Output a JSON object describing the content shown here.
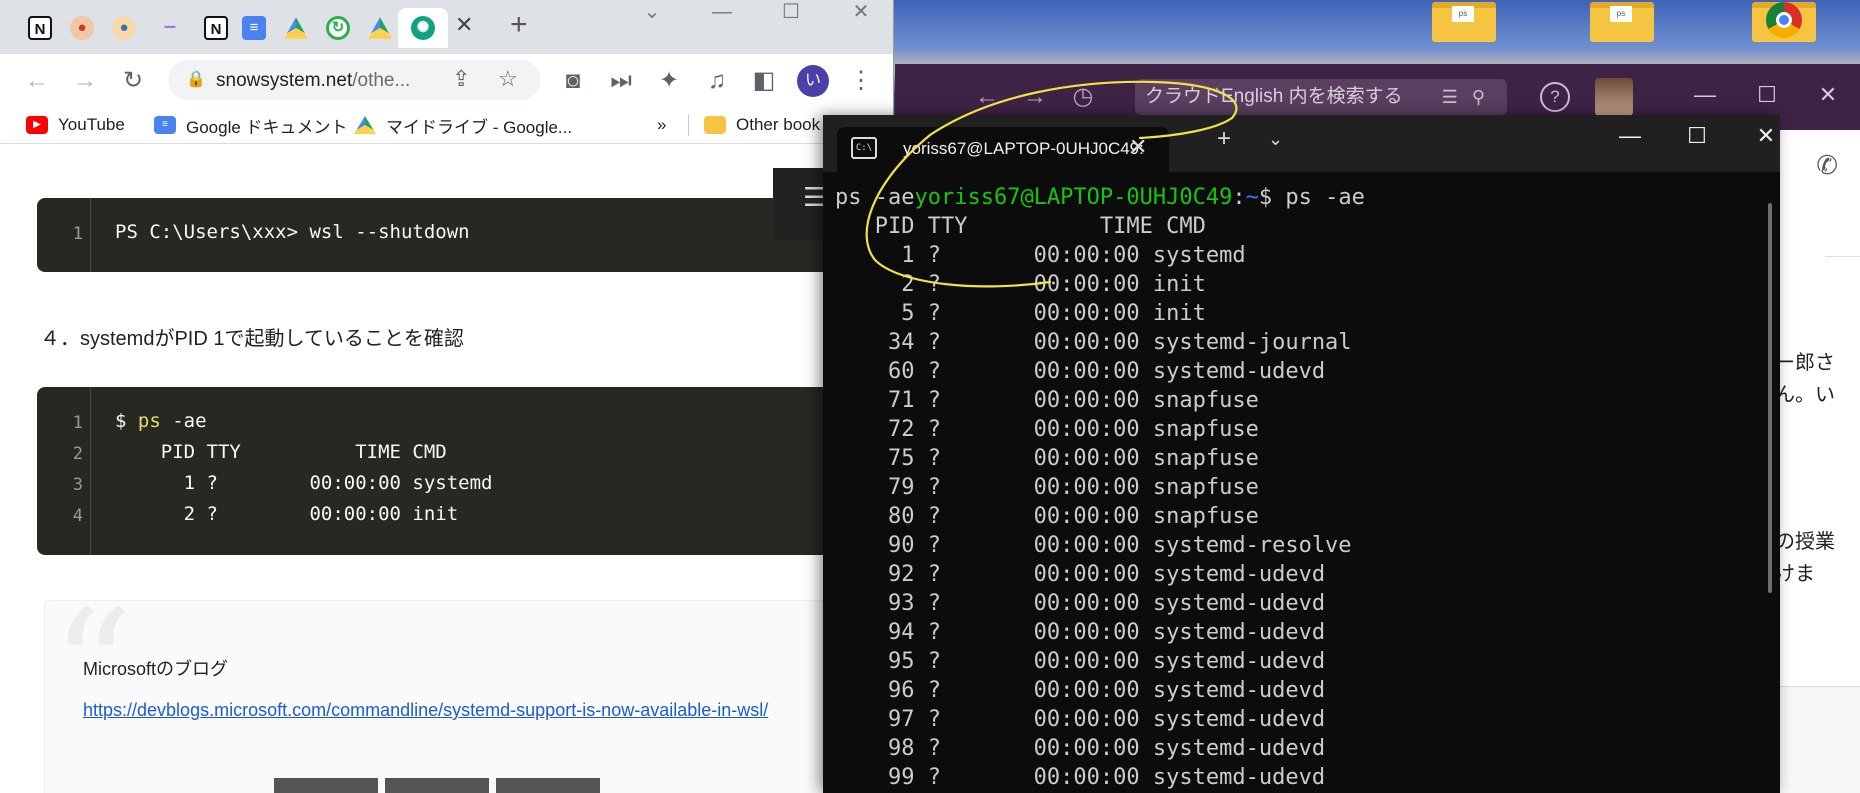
{
  "colors": {
    "terminal_bg": "#0c0c0c",
    "prompt_green": "#16c60c",
    "prompt_blue": "#3b78ff",
    "code_bg": "#272822",
    "slack_purple": "#3f2347",
    "annotation": "#f0e442"
  },
  "browser": {
    "tabs": [
      {
        "icon": "notion-icon",
        "glyph": "N",
        "cls": "notion"
      },
      {
        "icon": "avatar-icon",
        "glyph": "●",
        "cls": "person"
      },
      {
        "icon": "avatar-icon",
        "glyph": "●",
        "cls": "person2"
      },
      {
        "icon": "dash-icon",
        "glyph": "–",
        "cls": "dash"
      },
      {
        "icon": "notion-icon",
        "glyph": "N",
        "cls": "notion"
      },
      {
        "icon": "google-docs-icon",
        "glyph": "≡",
        "cls": "gdoc"
      },
      {
        "icon": "google-drive-icon",
        "glyph": "",
        "cls": "drive"
      },
      {
        "icon": "refresh-app-icon",
        "glyph": "↻",
        "cls": "green"
      },
      {
        "icon": "google-drive-icon",
        "glyph": "",
        "cls": "drive"
      },
      {
        "icon": "chatgpt-icon",
        "glyph": "✺",
        "cls": "gpt"
      }
    ],
    "url": {
      "host": "snowsystem.net",
      "path": "/othe..."
    },
    "profile_initial": "い",
    "bookmarks": [
      {
        "label": "YouTube",
        "icon": "youtube-icon",
        "cls": "yt",
        "glyph": "▶"
      },
      {
        "label": "Google ドキュメント",
        "icon": "google-docs-icon",
        "cls": "gd",
        "glyph": "≡"
      },
      {
        "label": "マイドライブ - Google...",
        "icon": "google-drive-icon",
        "cls": "dr",
        "glyph": ""
      }
    ],
    "bookmarks_more": "»",
    "other_bookmarks": "Other book"
  },
  "page": {
    "code1": [
      {
        "num": "1",
        "text": "PS C:\\Users\\xxx> wsl --shutdown"
      }
    ],
    "step4": "４．systemdがPID 1で起動していることを確認",
    "code2": [
      {
        "num": "1",
        "prefix": "$ ",
        "cmd": "ps",
        "rest": " -ae"
      },
      {
        "num": "2",
        "prefix": "",
        "cmd": "",
        "rest": "    PID TTY          TIME CMD"
      },
      {
        "num": "3",
        "prefix": "",
        "cmd": "",
        "rest": "      1 ?        00:00:00 systemd"
      },
      {
        "num": "4",
        "prefix": "",
        "cmd": "",
        "rest": "      2 ?        00:00:00 init"
      }
    ],
    "quote_title": "Microsoftのブログ",
    "quote_link": "https://devblogs.microsoft.com/commandline/systemd-support-is-now-available-in-wsl/"
  },
  "terminal": {
    "tab_title": "yoriss67@LAPTOP-0UHJ0C49:",
    "prompt_prefix": "ps -ae",
    "prompt_user": "yoriss67@LAPTOP-0UHJ0C49",
    "prompt_sep": ":",
    "prompt_path": "~",
    "prompt_cmd": "$ ps -ae",
    "header": "   PID TTY          TIME CMD",
    "processes": [
      {
        "pid": "1",
        "tty": "?",
        "time": "00:00:00",
        "cmd": "systemd"
      },
      {
        "pid": "2",
        "tty": "?",
        "time": "00:00:00",
        "cmd": "init"
      },
      {
        "pid": "5",
        "tty": "?",
        "time": "00:00:00",
        "cmd": "init"
      },
      {
        "pid": "34",
        "tty": "?",
        "time": "00:00:00",
        "cmd": "systemd-journal"
      },
      {
        "pid": "60",
        "tty": "?",
        "time": "00:00:00",
        "cmd": "systemd-udevd"
      },
      {
        "pid": "71",
        "tty": "?",
        "time": "00:00:00",
        "cmd": "snapfuse"
      },
      {
        "pid": "72",
        "tty": "?",
        "time": "00:00:00",
        "cmd": "snapfuse"
      },
      {
        "pid": "75",
        "tty": "?",
        "time": "00:00:00",
        "cmd": "snapfuse"
      },
      {
        "pid": "79",
        "tty": "?",
        "time": "00:00:00",
        "cmd": "snapfuse"
      },
      {
        "pid": "80",
        "tty": "?",
        "time": "00:00:00",
        "cmd": "snapfuse"
      },
      {
        "pid": "90",
        "tty": "?",
        "time": "00:00:00",
        "cmd": "systemd-resolve"
      },
      {
        "pid": "92",
        "tty": "?",
        "time": "00:00:00",
        "cmd": "systemd-udevd"
      },
      {
        "pid": "93",
        "tty": "?",
        "time": "00:00:00",
        "cmd": "systemd-udevd"
      },
      {
        "pid": "94",
        "tty": "?",
        "time": "00:00:00",
        "cmd": "systemd-udevd"
      },
      {
        "pid": "95",
        "tty": "?",
        "time": "00:00:00",
        "cmd": "systemd-udevd"
      },
      {
        "pid": "96",
        "tty": "?",
        "time": "00:00:00",
        "cmd": "systemd-udevd"
      },
      {
        "pid": "97",
        "tty": "?",
        "time": "00:00:00",
        "cmd": "systemd-udevd"
      },
      {
        "pid": "98",
        "tty": "?",
        "time": "00:00:00",
        "cmd": "systemd-udevd"
      },
      {
        "pid": "99",
        "tty": "?",
        "time": "00:00:00",
        "cmd": "systemd-udevd"
      }
    ]
  },
  "background_app": {
    "search_placeholder": "クラウドEnglish 内を検索する",
    "fragments": [
      "ー郎さ",
      "ん。い",
      "の授業",
      "けま"
    ]
  }
}
